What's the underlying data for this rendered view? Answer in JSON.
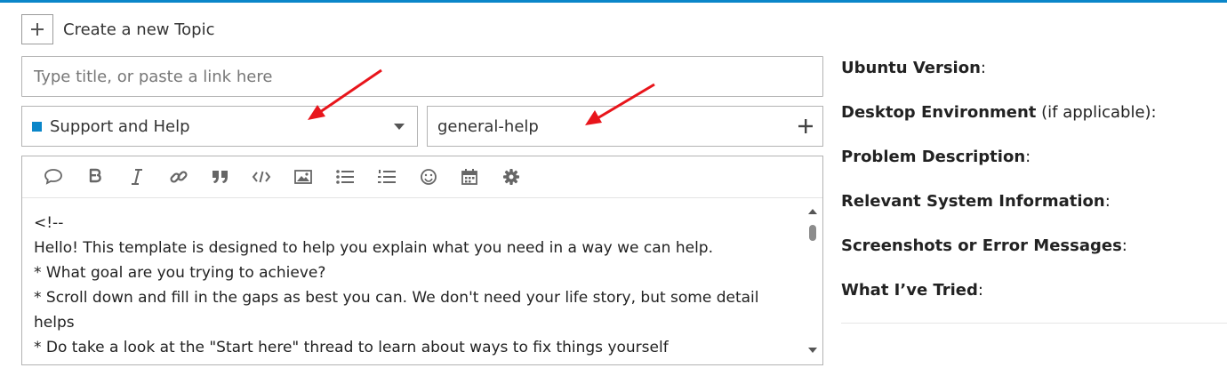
{
  "header": {
    "title": "Create a new Topic",
    "add_icon": "plus-icon"
  },
  "composer": {
    "title_placeholder": "Type title, or paste a link here",
    "title_value": "",
    "category": {
      "label": "Support and Help",
      "color": "#0a86c9"
    },
    "tags": {
      "value": "general-help"
    },
    "toolbar": [
      "speech-bubble-icon",
      "bold-icon",
      "italic-icon",
      "link-icon",
      "quote-icon",
      "code-icon",
      "image-icon",
      "bullet-list-icon",
      "numbered-list-icon",
      "emoji-icon",
      "calendar-icon",
      "gear-icon"
    ],
    "body": "<!--\nHello! This template is designed to help you explain what you need in a way we can help.\n* What goal are you trying to achieve?\n* Scroll down and fill in the gaps as best you can. We don't need your life story, but some detail helps\n* Do take a look at the \"Start here\" thread to learn about ways to fix things yourself"
  },
  "preview": {
    "lines": [
      {
        "label": "Ubuntu Version",
        "suffix": ":"
      },
      {
        "label": "Desktop Environment",
        "suffix": " (if applicable):"
      },
      {
        "label": "Problem Description",
        "suffix": ":"
      },
      {
        "label": "Relevant System Information",
        "suffix": ":"
      },
      {
        "label": "Screenshots or Error Messages",
        "suffix": ":"
      },
      {
        "label": "What I’ve Tried",
        "suffix": ":"
      }
    ]
  },
  "colors": {
    "accent": "#0a86c9",
    "annotation_arrow": "#e8151b"
  }
}
